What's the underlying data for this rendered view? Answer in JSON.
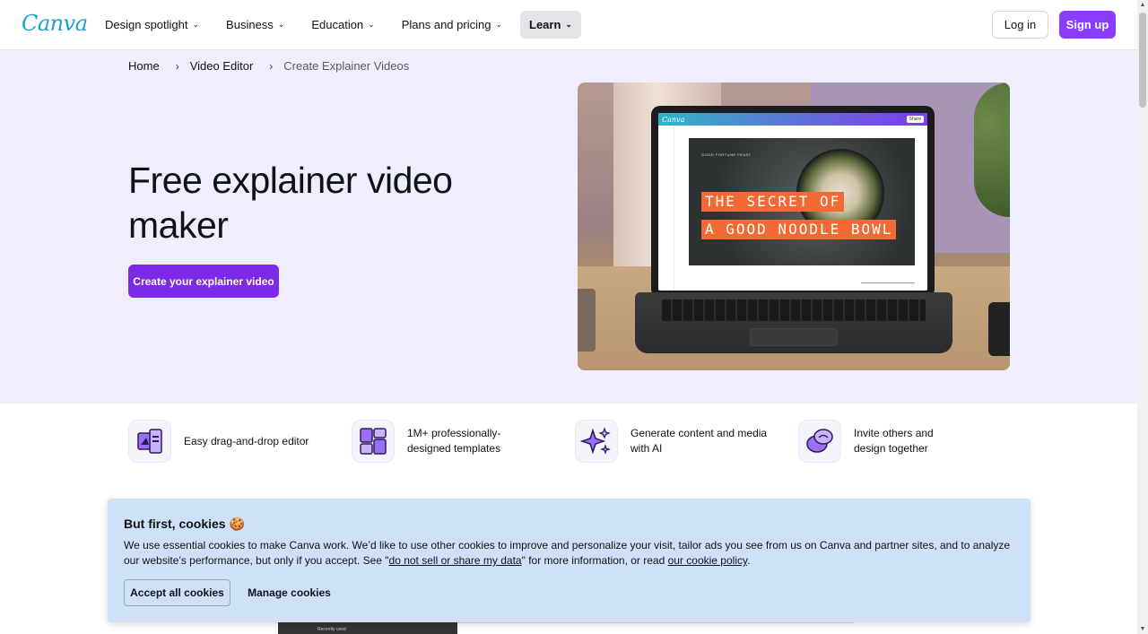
{
  "header": {
    "logo": "Canva",
    "menu": [
      {
        "label": "Design spotlight"
      },
      {
        "label": "Business"
      },
      {
        "label": "Education"
      },
      {
        "label": "Plans and pricing"
      },
      {
        "label": "Learn"
      }
    ],
    "login_label": "Log in",
    "signup_label": "Sign up"
  },
  "breadcrumb": {
    "items": [
      "Home",
      "Video Editor",
      "Create Explainer Videos"
    ]
  },
  "hero": {
    "title": "Free explainer video maker",
    "cta_label": "Create your explainer video",
    "image": {
      "app_logo": "Canva",
      "share_label": "Share",
      "brand_tag": "GOOD FORTUNE FEAST",
      "headline_line1": "THE SECRET OF",
      "headline_line2": "A GOOD NOODLE BOWL"
    }
  },
  "features": [
    {
      "text": "Easy drag-and-drop editor",
      "icon": "drag-drop-editor-icon"
    },
    {
      "text": "1M+ professionally-designed templates",
      "icon": "templates-icon"
    },
    {
      "text": "Generate content and media with AI",
      "icon": "ai-sparkle-icon"
    },
    {
      "text": "Invite others and design together",
      "icon": "collaborate-chat-icon"
    }
  ],
  "cookie": {
    "title": "But first, cookies 🍪",
    "text_before": "We use essential cookies to make Canva work. We’d like to use other cookies to improve and personalize your visit, tailor ads you see from us on Canva and partner sites, and to analyze our website’s performance, but only if you accept. See \"",
    "link1": "do not sell or share my data",
    "text_middle": "\" for more information, or read ",
    "link2": "our cookie policy",
    "text_after": ".",
    "accept_label": "Accept all cookies",
    "manage_label": "Manage cookies"
  },
  "peek": {
    "label": "Recently used"
  },
  "colors": {
    "brand_purple": "#8b3dff",
    "hero_bg": "#f0eefd",
    "cookie_bg": "#cfe0f9"
  }
}
